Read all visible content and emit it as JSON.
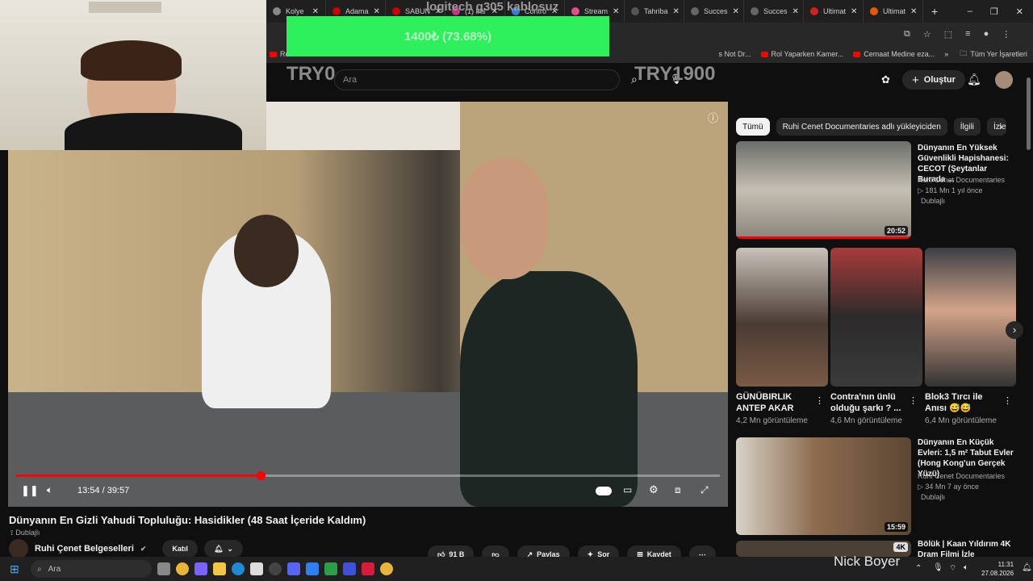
{
  "browser": {
    "tabs": [
      {
        "label": "Kolye",
        "color": "#888888"
      },
      {
        "label": "Adama",
        "color": "#cc0000"
      },
      {
        "label": "SABUN",
        "color": "#cc0000"
      },
      {
        "label": "(1) İns",
        "color": "#c13584"
      },
      {
        "label": "Contro",
        "color": "#3a7bd5"
      },
      {
        "label": "Stream",
        "color": "#e94b8a"
      },
      {
        "label": "Tahriba",
        "color": "#555555"
      },
      {
        "label": "Succes",
        "color": "#666666"
      },
      {
        "label": "Succes",
        "color": "#666666"
      },
      {
        "label": "Ultimat",
        "color": "#d12020"
      },
      {
        "label": "Ultimat",
        "color": "#e05a00"
      }
    ],
    "new_tab": "+",
    "window_controls": [
      "–",
      "❐",
      "✕"
    ],
    "bookmarks": [
      {
        "label": "Ro",
        "icon": "youtube"
      },
      {
        "label": "s Not Dr...",
        "icon": ""
      },
      {
        "label": "Rol Yaparken Kamer...",
        "icon": "youtube"
      },
      {
        "label": "Cemaat Medine eza...",
        "icon": "youtube"
      }
    ],
    "bookmarks_more": "»",
    "all_bookmarks": "Tüm Yer İşaretleri"
  },
  "overlay": {
    "donation_title": "logitech g305 kablosuz",
    "progress_text": "1400₺ (73.68%)",
    "progress_fraction": 0.7368,
    "min_label": "TRY0",
    "max_label": "TRY1900",
    "streamer_name": "Nick Boyer"
  },
  "youtube": {
    "search_placeholder": "Ara",
    "create_label": "Oluştur",
    "video": {
      "title": "Dünyanın En Gizli Yahudi Topluluğu: Hasidikler (48 Saat İçeride Kaldım)",
      "badge": "Dublajlı",
      "time_current": "13:54",
      "time_total": "39:57",
      "time_text": "13:54 / 39:57",
      "progress_fraction": 0.348,
      "channel": "Ruhi Çenet Belgeselleri",
      "subscribe_label": "Katıl",
      "likes": "91 B",
      "share_label": "Paylaş",
      "ask_label": "Sor",
      "save_label": "Kaydet",
      "more_label": "⋯"
    },
    "chips": [
      "Tümü",
      "Ruhi Cenet Documentaries adlı yükleyiciden",
      "İlgili",
      "İzle"
    ],
    "recommendations": [
      {
        "title": "Dünyanın En Yüksek Güvenlikli Hapishanesi: CECOT (Şeytanlar Burada ...",
        "channel": "Ruhi Cenet Documentaries",
        "meta": "▷ 181 Mn  1 yıl önce",
        "badge": "Dublajlı",
        "duration": "20:52"
      },
      {
        "title": "Dünyanın En Küçük Evleri: 1,5 m² Tabut Evler (Hong Kong'un Gerçek Yüzü)",
        "channel": "Ruhi Cenet Documentaries",
        "meta": "▷ 34 Mn  7 ay önce",
        "badge": "Dublajlı",
        "duration": "15:59"
      },
      {
        "title": "Bölük | Kaan Yıldırım 4K Dram Filmi İzle",
        "channel": "",
        "meta": "",
        "badge": "",
        "duration": "4K"
      }
    ],
    "shorts": [
      {
        "title": "GÜNÜBIRLIK ANTEP AKAR",
        "views": "4,2 Mn görüntüleme"
      },
      {
        "title": "Contra'nın ünlü olduğu şarkı ? ...",
        "views": "4,6 Mn görüntüleme"
      },
      {
        "title": "Blok3 Tırcı ile Anısı 😅😅",
        "views": "6,4 Mn görüntüleme"
      }
    ]
  },
  "taskbar": {
    "search_placeholder": "Ara",
    "time": "11:31",
    "date": "27.08.2026"
  },
  "colors": {
    "yt_red": "#ff0000",
    "donation_green": "#2ef05c",
    "background": "#0f0f0f"
  }
}
